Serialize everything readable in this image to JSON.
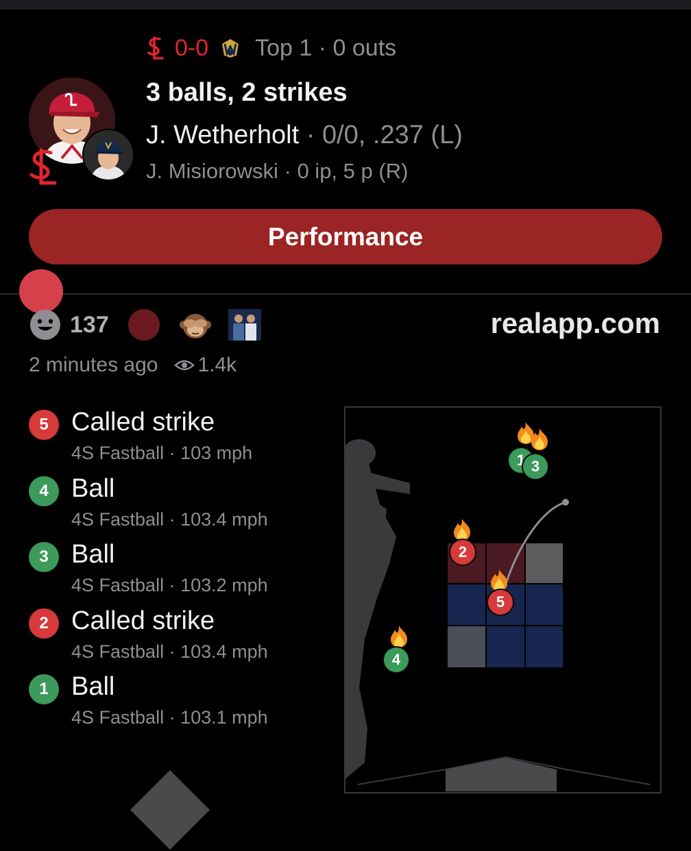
{
  "game": {
    "score": "0-0",
    "inning_status": "Top 1 · 0 outs"
  },
  "at_bat": {
    "count": "3 balls, 2 strikes",
    "batter_name": "J. Wetherholt",
    "batter_stats": " · 0/0, .237 (L)",
    "pitcher_line": "J. Misiorowski · 0 ip, 5 p (R)"
  },
  "actions": {
    "performance_label": "Performance"
  },
  "social": {
    "reaction_count": "137",
    "site": "realapp.com",
    "time_ago": "2 minutes ago",
    "views": "1.4k"
  },
  "pitches": [
    {
      "number": "5",
      "result": "Called strike",
      "type": "4S Fastball",
      "speed": "103 mph",
      "kind": "strike"
    },
    {
      "number": "4",
      "result": "Ball",
      "type": "4S Fastball",
      "speed": "103.4 mph",
      "kind": "ball"
    },
    {
      "number": "3",
      "result": "Ball",
      "type": "4S Fastball",
      "speed": "103.2 mph",
      "kind": "ball"
    },
    {
      "number": "2",
      "result": "Called strike",
      "type": "4S Fastball",
      "speed": "103.4 mph",
      "kind": "strike"
    },
    {
      "number": "1",
      "result": "Ball",
      "type": "4S Fastball",
      "speed": "103.1 mph",
      "kind": "ball"
    }
  ],
  "zone_markers": [
    {
      "label": "1",
      "kind": "ball"
    },
    {
      "label": "3",
      "kind": "ball"
    },
    {
      "label": "2",
      "kind": "strike"
    },
    {
      "label": "5",
      "kind": "strike"
    },
    {
      "label": "4",
      "kind": "ball"
    }
  ],
  "colors": {
    "strike": "#d63a3a",
    "ball": "#3c9a5a",
    "button": "#9b2424",
    "cardinals_red": "#e0262f"
  }
}
